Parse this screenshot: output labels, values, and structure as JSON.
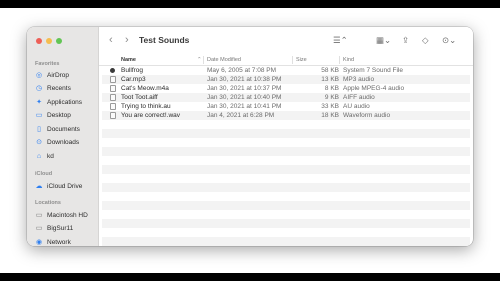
{
  "window": {
    "title": "Test Sounds"
  },
  "sidebar": {
    "favorites_label": "Favorites",
    "icloud_label": "iCloud",
    "locations_label": "Locations",
    "favorites": [
      {
        "label": "AirDrop",
        "icon": "airdrop-icon",
        "glyph": "◎"
      },
      {
        "label": "Recents",
        "icon": "clock-icon",
        "glyph": "◷"
      },
      {
        "label": "Applications",
        "icon": "applications-icon",
        "glyph": "✦"
      },
      {
        "label": "Desktop",
        "icon": "desktop-icon",
        "glyph": "▭"
      },
      {
        "label": "Documents",
        "icon": "document-icon",
        "glyph": "▯"
      },
      {
        "label": "Downloads",
        "icon": "download-icon",
        "glyph": "⊙"
      },
      {
        "label": "kd",
        "icon": "home-icon",
        "glyph": "⌂"
      }
    ],
    "icloud": [
      {
        "label": "iCloud Drive",
        "icon": "cloud-icon",
        "glyph": "☁"
      }
    ],
    "locations": [
      {
        "label": "Macintosh HD",
        "icon": "disk-icon",
        "glyph": "▭"
      },
      {
        "label": "BigSur11",
        "icon": "disk-icon",
        "glyph": "▭"
      },
      {
        "label": "Network",
        "icon": "network-icon",
        "glyph": "◉"
      }
    ]
  },
  "columns": {
    "name": "Name",
    "date": "Date Modified",
    "size": "Size",
    "kind": "Kind"
  },
  "files": [
    {
      "name": "Bullfrog",
      "date": "May 6, 2005 at 7:08 PM",
      "size": "58 KB",
      "kind": "System 7 Sound File",
      "icon_style": "dark"
    },
    {
      "name": "Car.mp3",
      "date": "Jan 30, 2021 at 10:38 PM",
      "size": "13 KB",
      "kind": "MP3 audio",
      "icon_style": "doc"
    },
    {
      "name": "Cat's Meow.m4a",
      "date": "Jan 30, 2021 at 10:37 PM",
      "size": "8 KB",
      "kind": "Apple MPEG-4 audio",
      "icon_style": "doc"
    },
    {
      "name": "Toot Toot.aiff",
      "date": "Jan 30, 2021 at 10:40 PM",
      "size": "9 KB",
      "kind": "AIFF audio",
      "icon_style": "doc"
    },
    {
      "name": "Trying to think.au",
      "date": "Jan 30, 2021 at 10:41 PM",
      "size": "33 KB",
      "kind": "AU audio",
      "icon_style": "doc"
    },
    {
      "name": "You are correct!.wav",
      "date": "Jan 4, 2021 at 6:28 PM",
      "size": "18 KB",
      "kind": "Waveform audio",
      "icon_style": "doc"
    }
  ]
}
